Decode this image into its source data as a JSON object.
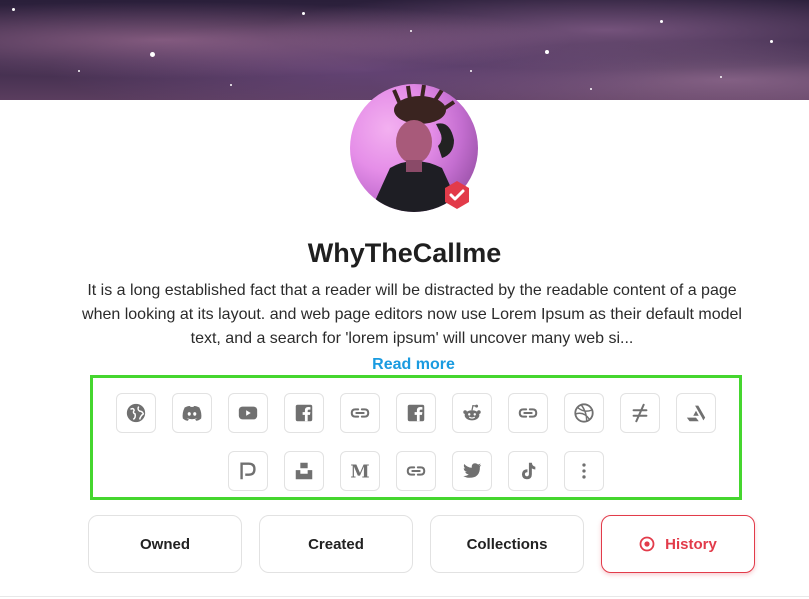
{
  "profile": {
    "name": "WhyTheCallme",
    "description": "It is a long established fact that a reader will be distracted by the readable content of a page when looking at its layout. and web page editors now use Lorem Ipsum as their default model text, and a search for 'lorem ipsum' will uncover many web si...",
    "read_more": "Read more",
    "verified": true
  },
  "social_links": {
    "row1": [
      "globe-icon",
      "discord-icon",
      "youtube-icon",
      "facebook-icon",
      "link-icon",
      "facebook-icon",
      "reddit-icon",
      "link-icon",
      "dribbble-icon",
      "not-equal-icon",
      "artstation-icon"
    ],
    "row2": [
      "patreon-icon",
      "unsplash-icon",
      "medium-icon",
      "link-icon",
      "twitter-icon",
      "tiktok-icon",
      "more-icon"
    ]
  },
  "tabs": [
    {
      "label": "Owned",
      "active": false
    },
    {
      "label": "Created",
      "active": false
    },
    {
      "label": "Collections",
      "active": false
    },
    {
      "label": "History",
      "active": true
    }
  ],
  "colors": {
    "accent": "#e23b4a",
    "link": "#1a9be0",
    "highlight": "#45d62f",
    "icon": "#707070"
  }
}
